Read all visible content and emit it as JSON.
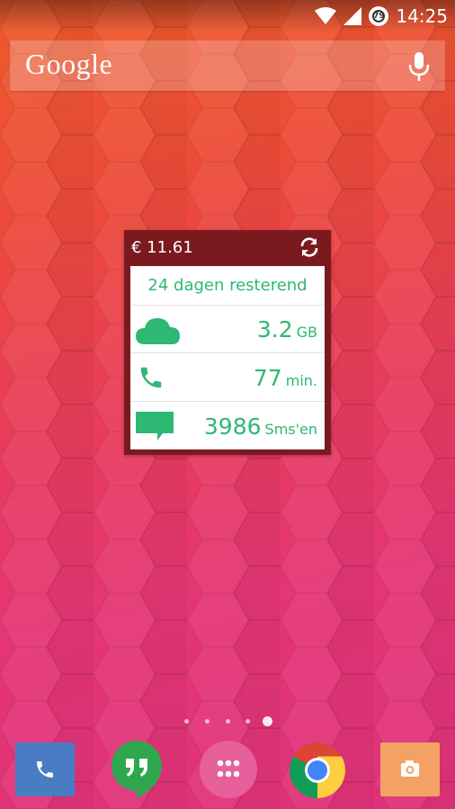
{
  "status_bar": {
    "time": "14:25",
    "battery_level": "79",
    "icons": [
      "wifi-icon",
      "signal-icon",
      "battery-icon"
    ]
  },
  "search_widget": {
    "logo_text": "Google",
    "icons": [
      "mic-icon"
    ]
  },
  "usage_widget": {
    "balance": "€ 11.61",
    "days_remaining": "24 dagen resterend",
    "rows": [
      {
        "icon": "cloud-icon",
        "value": "3.2",
        "unit": "GB"
      },
      {
        "icon": "phone-icon",
        "value": "77",
        "unit": "min."
      },
      {
        "icon": "message-icon",
        "value": "3986",
        "unit": "Sms'en"
      }
    ],
    "colors": {
      "frame": "#7a1a1f",
      "accent": "#2db873"
    }
  },
  "home_pages": {
    "count": 5,
    "active_index": 4
  },
  "dock": {
    "apps": [
      {
        "name": "phone",
        "icon": "phone-icon",
        "color": "#4a7cc4"
      },
      {
        "name": "hangouts",
        "icon": "hangouts-icon",
        "color": "#2fa74f"
      },
      {
        "name": "app-drawer",
        "icon": "app-drawer-icon",
        "color": "#e8609b"
      },
      {
        "name": "chrome",
        "icon": "chrome-icon",
        "color": "#db4437"
      },
      {
        "name": "camera",
        "icon": "camera-icon",
        "color": "#f4a263"
      }
    ]
  }
}
